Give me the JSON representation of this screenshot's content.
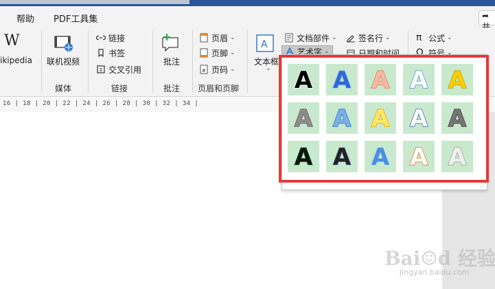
{
  "menu": {
    "help": "帮助",
    "pdf_tools": "PDF工具集",
    "share": "➦共"
  },
  "ribbon": {
    "wikipedia": "ikipedia",
    "online_video": "联机视频",
    "media_label": "媒体",
    "link": "链接",
    "bookmark": "书签",
    "cross_ref": "交叉引用",
    "links_label": "链接",
    "comment": "批注",
    "comments_label": "批注",
    "header": "页眉",
    "footer": "页脚",
    "page_number": "页码",
    "header_footer_label": "页眉和页脚",
    "text_box": "文本框",
    "quick_parts": "文档部件",
    "wordart": "艺术字",
    "signature_line": "签名行",
    "datetime": "日期和时间",
    "equation": "公式",
    "symbol": "符号"
  },
  "ruler": {
    "numbers": "16 | 18 | 20 | 22 | 24 | 26 | 28 | 30 | 32 | 34 |"
  },
  "gallery": {
    "tile_letter": "A",
    "styles": [
      {
        "fill": "#000000",
        "stroke": "#ffffff"
      },
      {
        "fill": "#2f6bd6",
        "stroke": "#9ebcf0"
      },
      {
        "fill": "#f6b9a5",
        "stroke": "#e0734f"
      },
      {
        "fill": "#ffffff",
        "stroke": "#4a84d4"
      },
      {
        "fill": "#f5d000",
        "stroke": "#c99700"
      },
      {
        "fill": "#8c8c8c",
        "stroke": "#5a5a5a"
      },
      {
        "fill": "#7ab0ea",
        "stroke": "#2e6fc4"
      },
      {
        "fill": "#ffe766",
        "stroke": "#e0a500"
      },
      {
        "fill": "#ffffff",
        "stroke": "#2e5fae"
      },
      {
        "fill": "#767676",
        "stroke": "#3a3a3a"
      },
      {
        "fill": "#111111",
        "stroke": "#3ec24f"
      },
      {
        "fill": "#222222",
        "stroke": "#8fb3e8"
      },
      {
        "fill": "#4a8fe0",
        "stroke": "#b9d4f5"
      },
      {
        "fill": "#ffffff",
        "stroke": "#ee6a1a"
      },
      {
        "fill": "#f0f0f0",
        "stroke": "#9a9a9a"
      }
    ]
  },
  "watermark": {
    "text": "Bai☺d 经验",
    "sub": "jingyan.baidu.com"
  }
}
